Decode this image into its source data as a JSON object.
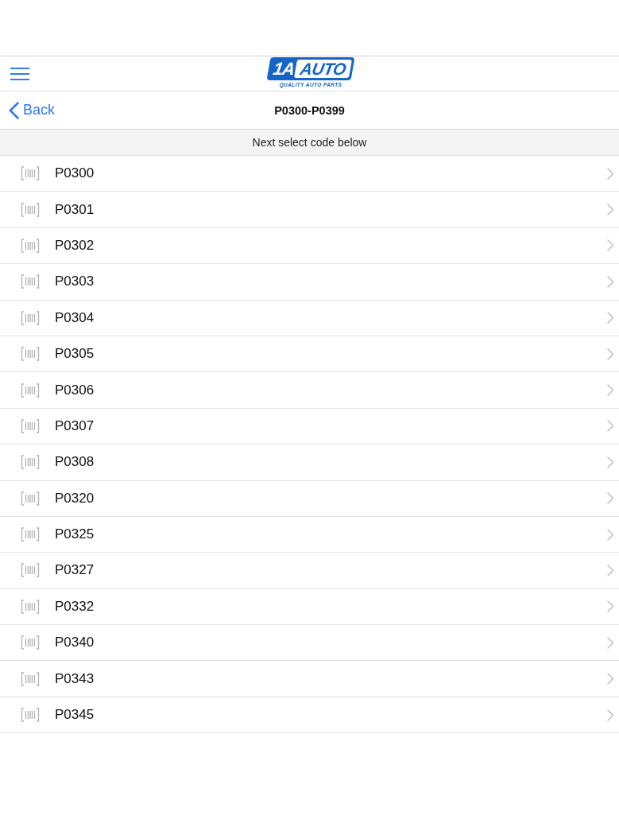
{
  "header": {
    "logo": {
      "mark": "1A",
      "word": "AUTO",
      "tagline": "QUALITY AUTO PARTS"
    }
  },
  "nav": {
    "back": "Back",
    "title": "P0300-P0399"
  },
  "section_header": "Next select code below",
  "codes": [
    {
      "code": "P0300"
    },
    {
      "code": "P0301"
    },
    {
      "code": "P0302"
    },
    {
      "code": "P0303"
    },
    {
      "code": "P0304"
    },
    {
      "code": "P0305"
    },
    {
      "code": "P0306"
    },
    {
      "code": "P0307"
    },
    {
      "code": "P0308"
    },
    {
      "code": "P0320"
    },
    {
      "code": "P0325"
    },
    {
      "code": "P0327"
    },
    {
      "code": "P0332"
    },
    {
      "code": "P0340"
    },
    {
      "code": "P0343"
    },
    {
      "code": "P0345"
    }
  ]
}
